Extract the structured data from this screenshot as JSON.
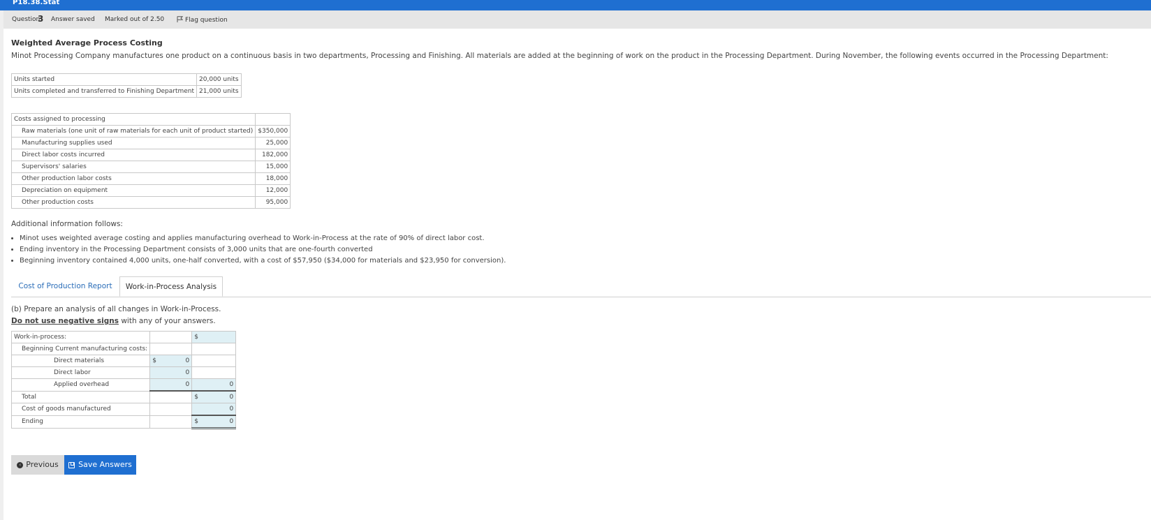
{
  "window": {
    "title": "P18.38.Stat"
  },
  "question_bar": {
    "question_label": "Question",
    "question_number": "3",
    "status": "Answer saved",
    "marks": "Marked out of 2.50",
    "flag": "Flag question"
  },
  "problem": {
    "heading": "Weighted Average Process Costing",
    "intro": "Minot Processing Company manufactures one product on a continuous basis in two departments, Processing and Finishing. All materials are added at the beginning of work on the product in the Processing Department. During November, the following events occurred in the Processing Department:"
  },
  "units_table": [
    {
      "label": "Units started",
      "value": "20,000 units"
    },
    {
      "label": "Units completed and transferred to Finishing Department",
      "value": "21,000 units"
    }
  ],
  "costs_table": {
    "header": "Costs assigned to processing",
    "rows": [
      {
        "label": "Raw materials (one unit of raw materials for each unit of product started)",
        "value": "$350,000"
      },
      {
        "label": "Manufacturing supplies used",
        "value": "25,000"
      },
      {
        "label": "Direct labor costs incurred",
        "value": "182,000"
      },
      {
        "label": "Supervisors' salaries",
        "value": "15,000"
      },
      {
        "label": "Other production labor costs",
        "value": "18,000"
      },
      {
        "label": "Depreciation on equipment",
        "value": "12,000"
      },
      {
        "label": "Other production costs",
        "value": "95,000"
      }
    ]
  },
  "additional": {
    "heading": "Additional information follows:",
    "bullets": [
      "Minot uses weighted average costing and applies manufacturing overhead to Work-in-Process at the rate of 90% of direct labor cost.",
      "Ending inventory in the Processing Department consists of 3,000 units that are one-fourth converted",
      "Beginning inventory contained 4,000 units, one-half converted, with a cost of $57,950 ($34,000 for materials and $23,950 for conversion)."
    ]
  },
  "tabs": [
    {
      "label": "Cost of Production Report",
      "active": false
    },
    {
      "label": "Work-in-Process Analysis",
      "active": true
    }
  ],
  "part_b": {
    "instruction": "(b) Prepare an analysis of all changes in Work-in-Process.",
    "warning_underlined": "Do not use negative signs",
    "warning_rest": " with any of your answers."
  },
  "wip_table": {
    "title_row": {
      "label": "Work-in-process:",
      "symbol": "$"
    },
    "beginning_label": "Beginning Current manufacturing costs:",
    "rows": [
      {
        "label": "Direct materials",
        "symbol": "$",
        "value": "0"
      },
      {
        "label": "Direct labor",
        "value": "0"
      },
      {
        "label": "Applied overhead",
        "value": "0",
        "total": "0"
      }
    ],
    "total": {
      "label": "Total",
      "symbol": "$",
      "value": "0"
    },
    "cogm": {
      "label": "Cost of goods manufactured",
      "value": "0"
    },
    "ending": {
      "label": "Ending",
      "symbol": "$",
      "value": "0"
    }
  },
  "buttons": {
    "previous": "Previous",
    "save": "Save Answers"
  },
  "colors": {
    "brand": "#1f6fd1",
    "input_bg": "#dff0f5",
    "link": "#2a6db8"
  }
}
